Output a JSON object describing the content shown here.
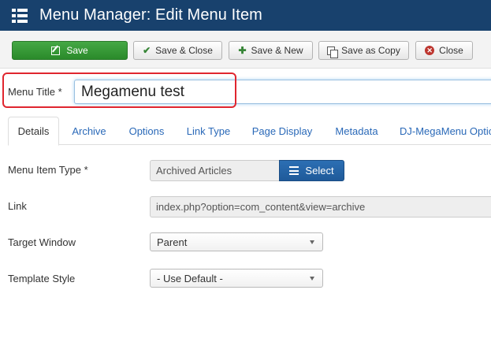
{
  "header": {
    "title": "Menu Manager: Edit Menu Item",
    "menu_icon": "hamburger-menu-icon"
  },
  "toolbar": {
    "save": "Save",
    "save_close": "Save & Close",
    "save_new": "Save & New",
    "save_copy": "Save as Copy",
    "close": "Close"
  },
  "form": {
    "title_label": "Menu Title *",
    "title_value": "Megamenu test"
  },
  "tabs": [
    {
      "label": "Details"
    },
    {
      "label": "Archive"
    },
    {
      "label": "Options"
    },
    {
      "label": "Link Type"
    },
    {
      "label": "Page Display"
    },
    {
      "label": "Metadata"
    },
    {
      "label": "DJ-MegaMenu Options"
    }
  ],
  "details": {
    "menu_item_type_label": "Menu Item Type *",
    "menu_item_type_value": "Archived Articles",
    "select_label": "Select",
    "link_label": "Link",
    "link_value": "index.php?option=com_content&view=archive",
    "target_window_label": "Target Window",
    "target_window_value": "Parent",
    "template_style_label": "Template Style",
    "template_style_value": "- Use Default -"
  },
  "colors": {
    "header_bg": "#18416d",
    "save_green": "#2a8a2a",
    "link_blue": "#2a69b8",
    "highlight_red": "#e0262f"
  }
}
